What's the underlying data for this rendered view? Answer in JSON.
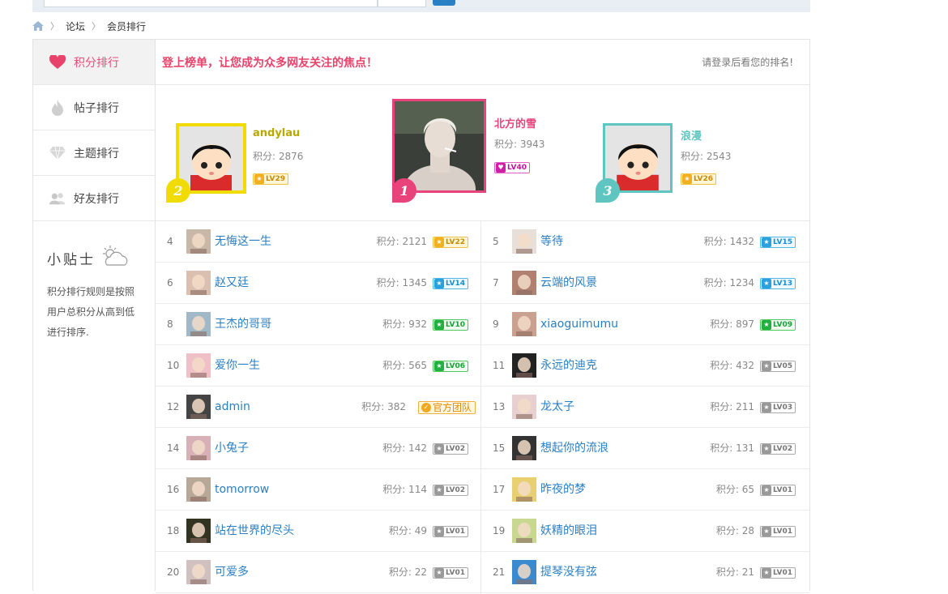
{
  "breadcrumb": {
    "items": [
      "论坛",
      "会员排行"
    ]
  },
  "sidebar": {
    "items": [
      {
        "label": "积分排行",
        "icon": "heart-icon",
        "active": true
      },
      {
        "label": "帖子排行",
        "icon": "fire-icon",
        "active": false
      },
      {
        "label": "主题排行",
        "icon": "diamond-icon",
        "active": false
      },
      {
        "label": "好友排行",
        "icon": "friends-icon",
        "active": false
      }
    ],
    "tip": {
      "title": "小贴士",
      "text": "积分排行规则是按照用户总积分从高到低进行排序."
    }
  },
  "banner": {
    "slogan": "登上榜单，让您成为众多网友关注的焦点！",
    "login_prompt": "请登录后看您的排名!"
  },
  "podium": {
    "first": {
      "rank": "1",
      "name": "北方的雪",
      "score": "积分: 3943",
      "level": "LV40",
      "color": "#e8437a"
    },
    "second": {
      "rank": "2",
      "name": "andylau",
      "score": "积分: 2876",
      "level": "LV29",
      "color": "#f0dc00"
    },
    "third": {
      "rank": "3",
      "name": "浪漫",
      "score": "积分: 2543",
      "level": "LV26",
      "color": "#5fc5c0"
    }
  },
  "rankings": [
    {
      "rank": "4",
      "name": "无悔这一生",
      "score": "积分: 2121",
      "level": "LV22",
      "tier": "gold"
    },
    {
      "rank": "5",
      "name": "等待",
      "score": "积分: 1432",
      "level": "LV15",
      "tier": "blue"
    },
    {
      "rank": "6",
      "name": "赵又廷",
      "score": "积分: 1345",
      "level": "LV14",
      "tier": "blue"
    },
    {
      "rank": "7",
      "name": "云端的风景",
      "score": "积分: 1234",
      "level": "LV13",
      "tier": "blue"
    },
    {
      "rank": "8",
      "name": "王杰的哥哥",
      "score": "积分: 932",
      "level": "LV10",
      "tier": "green"
    },
    {
      "rank": "9",
      "name": "xiaoguimumu",
      "score": "积分: 897",
      "level": "LV09",
      "tier": "green"
    },
    {
      "rank": "10",
      "name": "爱你一生",
      "score": "积分: 565",
      "level": "LV06",
      "tier": "green"
    },
    {
      "rank": "11",
      "name": "永远的迪克",
      "score": "积分: 432",
      "level": "LV05",
      "tier": "gray"
    },
    {
      "rank": "12",
      "name": "admin",
      "score": "积分: 382",
      "level": "官方团队",
      "tier": "team"
    },
    {
      "rank": "13",
      "name": "龙太子",
      "score": "积分: 211",
      "level": "LV03",
      "tier": "gray"
    },
    {
      "rank": "14",
      "name": "小兔子",
      "score": "积分: 142",
      "level": "LV02",
      "tier": "gray"
    },
    {
      "rank": "15",
      "name": "想起你的流浪",
      "score": "积分: 131",
      "level": "LV02",
      "tier": "gray"
    },
    {
      "rank": "16",
      "name": "tomorrow",
      "score": "积分: 114",
      "level": "LV02",
      "tier": "gray"
    },
    {
      "rank": "17",
      "name": "昨夜的梦",
      "score": "积分: 65",
      "level": "LV01",
      "tier": "gray"
    },
    {
      "rank": "18",
      "name": "站在世界的尽头",
      "score": "积分: 49",
      "level": "LV01",
      "tier": "gray"
    },
    {
      "rank": "19",
      "name": "妖精的眼泪",
      "score": "积分: 28",
      "level": "LV01",
      "tier": "gray"
    },
    {
      "rank": "20",
      "name": "可爱多",
      "score": "积分: 22",
      "level": "LV01",
      "tier": "gray"
    },
    {
      "rank": "21",
      "name": "提琴没有弦",
      "score": "积分: 21",
      "level": "LV01",
      "tier": "gray"
    }
  ],
  "colors": {
    "accent": "#e8436b",
    "link": "#2b7fc3"
  }
}
